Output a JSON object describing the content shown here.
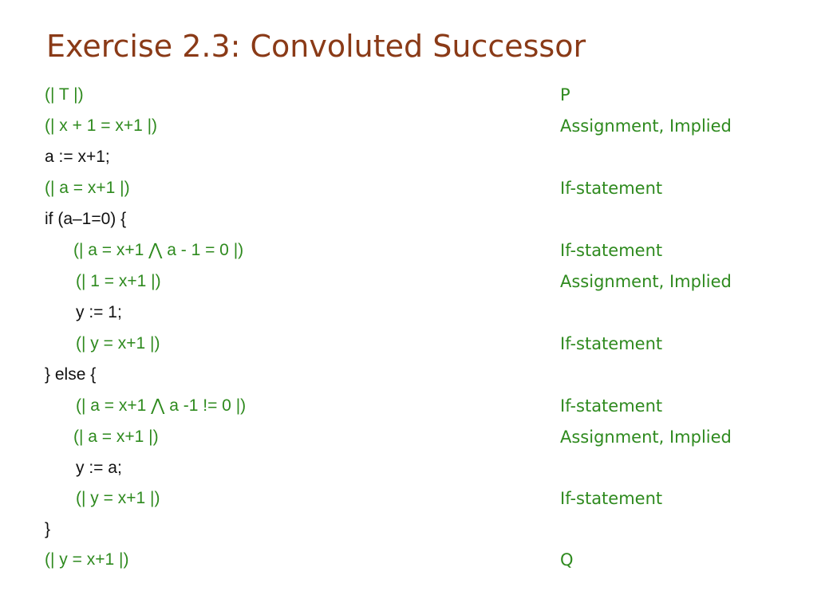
{
  "title": "Exercise 2.3: Convoluted Successor",
  "colors": {
    "title": "#8a3a17",
    "condition": "#2e8a1e",
    "code": "#111111"
  },
  "lines": [
    {
      "text": "(| T |)",
      "kind": "condition",
      "indent": 0,
      "justification": "P"
    },
    {
      "text": "(| x + 1 = x+1 |)",
      "kind": "condition",
      "indent": 0,
      "justification": "Assignment, Implied"
    },
    {
      "text": "a := x+1;",
      "kind": "code",
      "indent": 0,
      "justification": ""
    },
    {
      "text": "(| a = x+1 |)",
      "kind": "condition",
      "indent": 0,
      "justification": "If-statement"
    },
    {
      "text": "if (a–1=0) {",
      "kind": "code",
      "indent": 0,
      "justification": ""
    },
    {
      "text": "(| a = x+1 ⋀ a - 1 = 0 |)",
      "kind": "condition",
      "indent": 1,
      "justification": "If-statement"
    },
    {
      "text": "(| 1 = x+1 |)",
      "kind": "condition",
      "indent": 1,
      "justification": "Assignment, Implied"
    },
    {
      "text": "y := 1;",
      "kind": "code",
      "indent": 1,
      "justification": ""
    },
    {
      "text": "(| y = x+1 |)",
      "kind": "condition",
      "indent": 1,
      "justification": "If-statement"
    },
    {
      "text": "} else {",
      "kind": "code",
      "indent": 0,
      "justification": ""
    },
    {
      "text": "(| a = x+1 ⋀ a -1 != 0 |)",
      "kind": "condition",
      "indent": 1,
      "justification": "If-statement"
    },
    {
      "text": "(| a = x+1 |)",
      "kind": "condition",
      "indent": 1,
      "justification": "Assignment, Implied"
    },
    {
      "text": "y := a;",
      "kind": "code",
      "indent": 1,
      "justification": ""
    },
    {
      "text": "(| y = x+1 |)",
      "kind": "condition",
      "indent": 1,
      "justification": "If-statement"
    },
    {
      "text": "}",
      "kind": "code",
      "indent": 0,
      "justification": ""
    },
    {
      "text": "(| y = x+1 |)",
      "kind": "condition",
      "indent": 0,
      "justification": "Q"
    }
  ]
}
